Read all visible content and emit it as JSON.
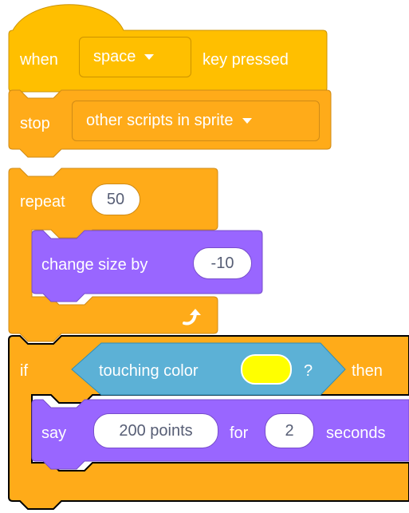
{
  "colors": {
    "events": "#ffbf00",
    "control": "#ffab19",
    "looks": "#9966ff",
    "sensing": "#5cb1d6",
    "input_text": "#575e75",
    "selected_outline": "#000000",
    "touching_color_value": "#ffff00"
  },
  "when_key_block": {
    "label_when": "when",
    "key_dropdown": "space",
    "label_key_pressed": "key pressed"
  },
  "stop_block": {
    "label_stop": "stop",
    "option_dropdown": "other scripts in sprite"
  },
  "repeat_block": {
    "label_repeat": "repeat",
    "times": "50",
    "loop_arrow_icon": "loop-arrow-icon",
    "change_size_block": {
      "label": "change size by",
      "amount": "-10"
    }
  },
  "if_block": {
    "label_if": "if",
    "label_then": "then",
    "condition": {
      "label_touching_color": "touching color",
      "label_question": "?"
    },
    "say_block": {
      "label_say": "say",
      "message": "200 points",
      "label_for": "for",
      "duration": "2",
      "label_seconds": "seconds"
    }
  }
}
